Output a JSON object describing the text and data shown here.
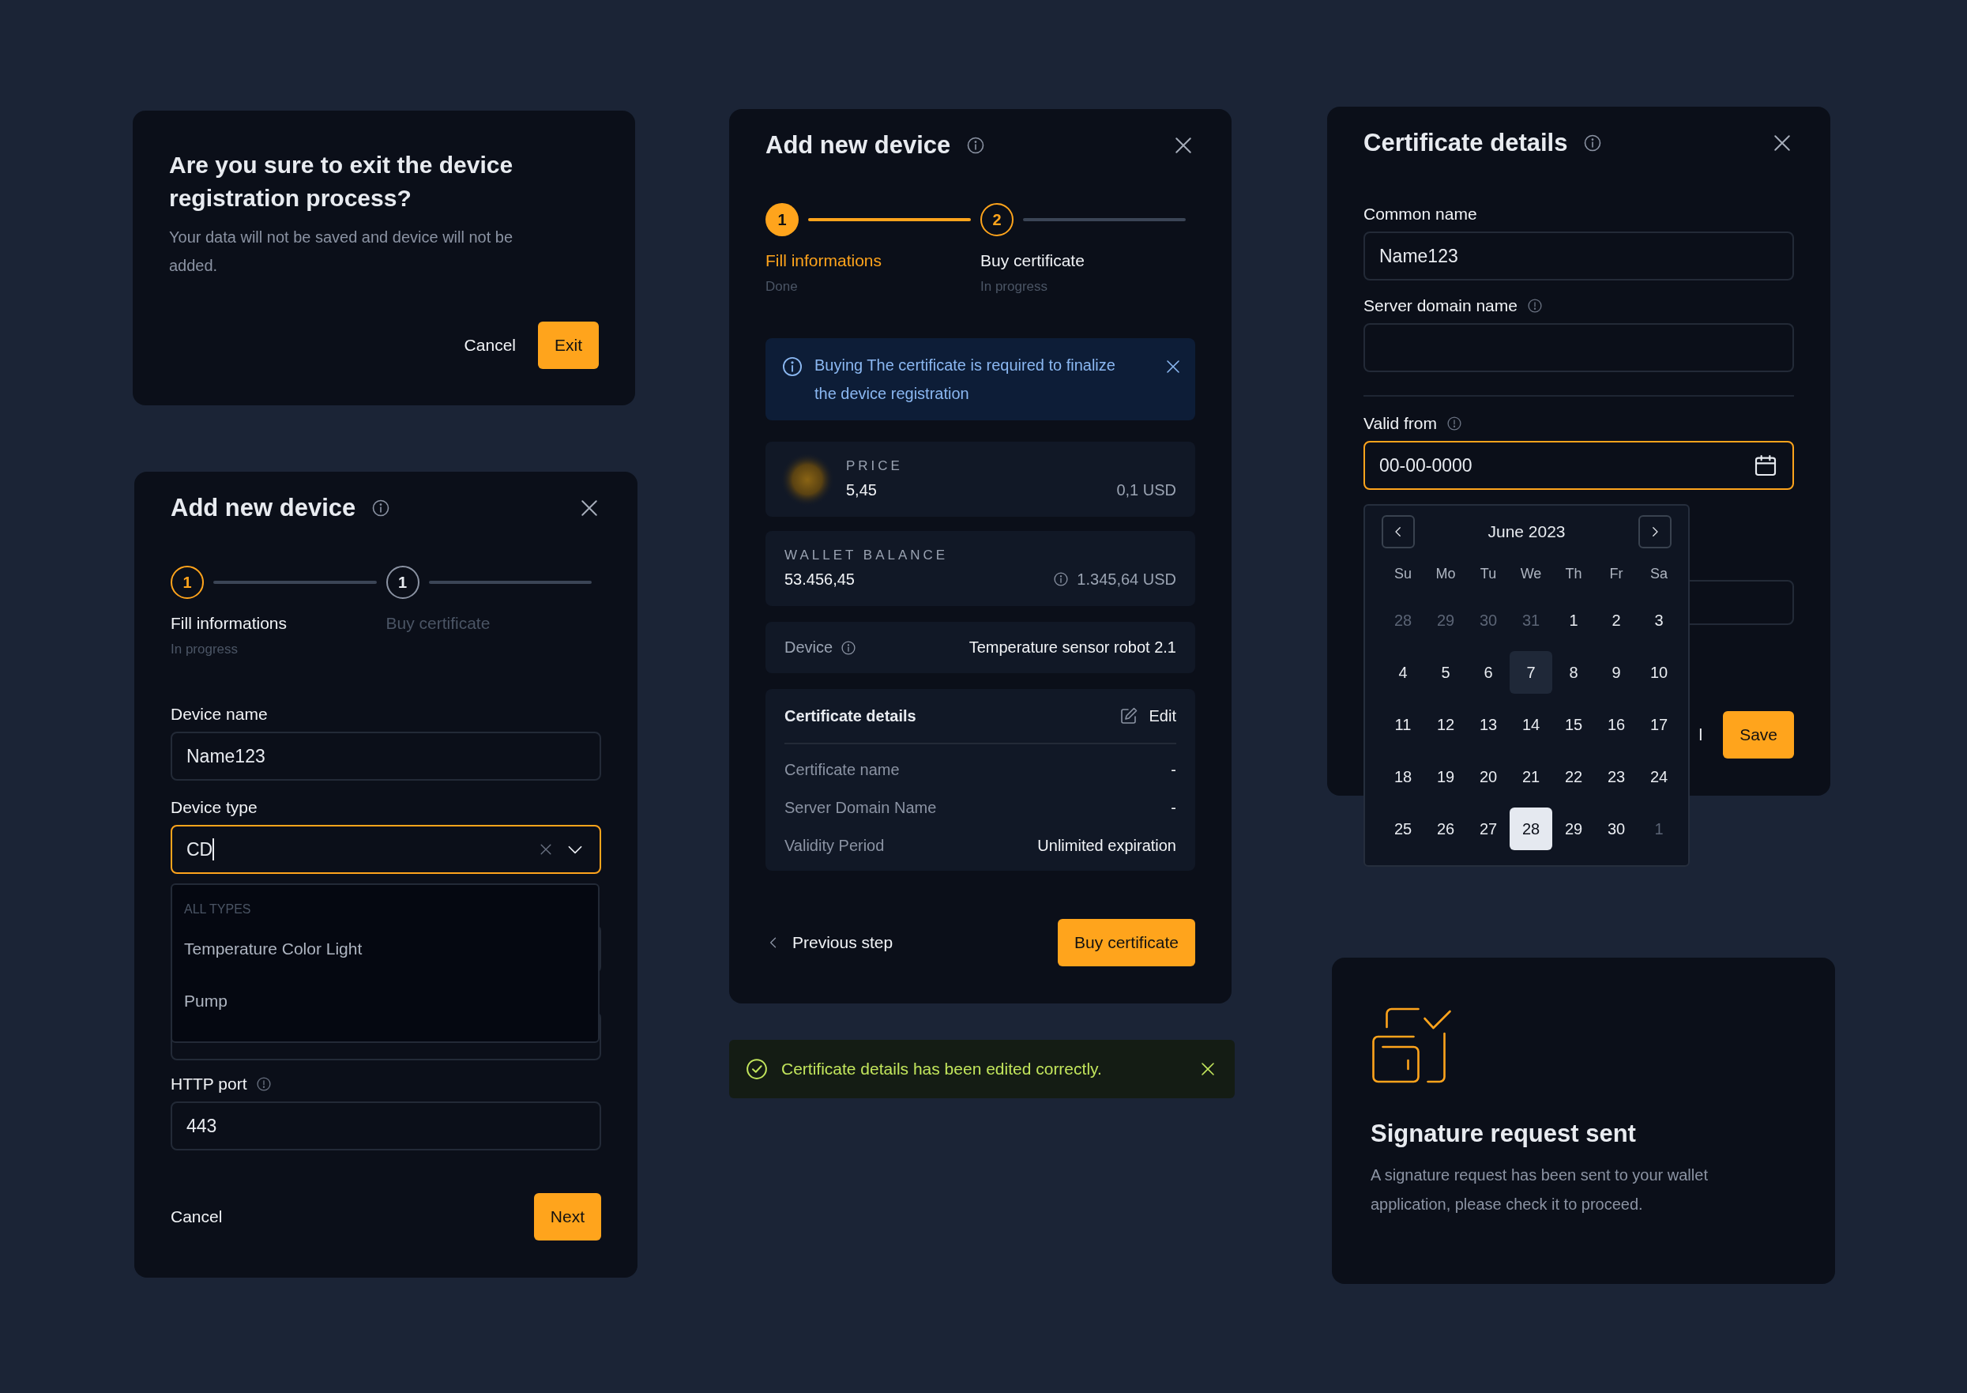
{
  "exit_dialog": {
    "title": "Are you sure to exit the device registration process?",
    "message": "Your data will not be saved and device will not be added.",
    "cancel": "Cancel",
    "confirm": "Exit"
  },
  "device_form": {
    "title": "Add new device",
    "steps": [
      {
        "number": "1",
        "label": "Fill informations",
        "status": "In progress",
        "done": false,
        "current": true
      },
      {
        "number": "1",
        "label": "Buy certificate",
        "done": false,
        "current": false
      }
    ],
    "fields": [
      {
        "kind": "text",
        "label": "Device name",
        "value": "Name123",
        "info": false,
        "focused": false
      },
      {
        "kind": "select",
        "label": "Device type",
        "value": "CD",
        "info": false,
        "focused": true
      },
      {
        "kind": "covered"
      },
      {
        "kind": "covered"
      },
      {
        "kind": "text",
        "label": "HTTP port",
        "value": "443",
        "info": true,
        "focused": false
      }
    ],
    "dropdown": {
      "group": "ALL TYPES",
      "options": [
        {
          "label": "Temperature Color Light"
        },
        {
          "label": "Pump"
        }
      ]
    },
    "cancel": "Cancel",
    "next": "Next"
  },
  "purchase": {
    "title": "Add new device",
    "steps": [
      {
        "number": "1",
        "label": "Fill informations",
        "status": "Done",
        "done": true,
        "current": false
      },
      {
        "number": "2",
        "label": "Buy certificate",
        "status": "In progress",
        "done": false,
        "current": true
      }
    ],
    "alert": {
      "message": "Buying The certificate is required to finalize the device registration"
    },
    "price": {
      "label": "PRICE",
      "amount": "5,45",
      "usd": "0,1 USD"
    },
    "wallet": {
      "label": "WALLET BALANCE",
      "amount": "53.456,45",
      "usd": "1.345,64 USD"
    },
    "device": {
      "label": "Device",
      "value": "Temperature sensor robot 2.1"
    },
    "certificate": {
      "title": "Certificate details",
      "edit": "Edit",
      "rows": [
        {
          "label": "Certificate name",
          "value": "-"
        },
        {
          "label": "Server Domain Name",
          "value": "-"
        },
        {
          "label": "Validity Period",
          "value": "Unlimited expiration"
        }
      ]
    },
    "back": "Previous step",
    "buy": "Buy certificate"
  },
  "toast": {
    "kind": "success",
    "message": "Certificate details has been edited correctly."
  },
  "cert_form": {
    "title": "Certificate details",
    "fields": [
      {
        "kind": "text",
        "label": "Common name",
        "value": "Name123",
        "info": false,
        "focused": false
      },
      {
        "kind": "text",
        "label": "Server domain name",
        "info": true,
        "focused": false
      },
      {
        "kind": "divider"
      },
      {
        "kind": "date",
        "label": "Valid from",
        "value": "00-00-0000",
        "info": true,
        "focused": true
      },
      {
        "kind": "covered"
      }
    ],
    "cancel_fragment": "l",
    "save": "Save",
    "calendar": {
      "month": "June 2023",
      "weekdays": [
        "Su",
        "Mo",
        "Tu",
        "We",
        "Th",
        "Fr",
        "Sa"
      ],
      "days": [
        {
          "day": "28",
          "outside": true,
          "today": false,
          "selected": false
        },
        {
          "day": "29",
          "outside": true,
          "today": false,
          "selected": false
        },
        {
          "day": "30",
          "outside": true,
          "today": false,
          "selected": false
        },
        {
          "day": "31",
          "outside": true,
          "today": false,
          "selected": false
        },
        {
          "day": "1",
          "outside": false,
          "today": false,
          "selected": false
        },
        {
          "day": "2",
          "outside": false,
          "today": false,
          "selected": false
        },
        {
          "day": "3",
          "outside": false,
          "today": false,
          "selected": false
        },
        {
          "day": "4",
          "outside": false,
          "today": false,
          "selected": false
        },
        {
          "day": "5",
          "outside": false,
          "today": false,
          "selected": false
        },
        {
          "day": "6",
          "outside": false,
          "today": false,
          "selected": false
        },
        {
          "day": "7",
          "outside": false,
          "today": true,
          "selected": false
        },
        {
          "day": "8",
          "outside": false,
          "today": false,
          "selected": false
        },
        {
          "day": "9",
          "outside": false,
          "today": false,
          "selected": false
        },
        {
          "day": "10",
          "outside": false,
          "today": false,
          "selected": false
        },
        {
          "day": "11",
          "outside": false,
          "today": false,
          "selected": false
        },
        {
          "day": "12",
          "outside": false,
          "today": false,
          "selected": false
        },
        {
          "day": "13",
          "outside": false,
          "today": false,
          "selected": false
        },
        {
          "day": "14",
          "outside": false,
          "today": false,
          "selected": false
        },
        {
          "day": "15",
          "outside": false,
          "today": false,
          "selected": false
        },
        {
          "day": "16",
          "outside": false,
          "today": false,
          "selected": false
        },
        {
          "day": "17",
          "outside": false,
          "today": false,
          "selected": false
        },
        {
          "day": "18",
          "outside": false,
          "today": false,
          "selected": false
        },
        {
          "day": "19",
          "outside": false,
          "today": false,
          "selected": false
        },
        {
          "day": "20",
          "outside": false,
          "today": false,
          "selected": false
        },
        {
          "day": "21",
          "outside": false,
          "today": false,
          "selected": false
        },
        {
          "day": "22",
          "outside": false,
          "today": false,
          "selected": false
        },
        {
          "day": "23",
          "outside": false,
          "today": false,
          "selected": false
        },
        {
          "day": "24",
          "outside": false,
          "today": false,
          "selected": false
        },
        {
          "day": "25",
          "outside": false,
          "today": false,
          "selected": false
        },
        {
          "day": "26",
          "outside": false,
          "today": false,
          "selected": false
        },
        {
          "day": "27",
          "outside": false,
          "today": false,
          "selected": false
        },
        {
          "day": "28",
          "outside": false,
          "today": false,
          "selected": true
        },
        {
          "day": "29",
          "outside": false,
          "today": false,
          "selected": false
        },
        {
          "day": "30",
          "outside": false,
          "today": false,
          "selected": false
        },
        {
          "day": "1",
          "outside": true,
          "today": false,
          "selected": false
        }
      ]
    }
  },
  "signature": {
    "title": "Signature request sent",
    "message": "A signature request has been sent to your wallet application, please check it to proceed."
  }
}
